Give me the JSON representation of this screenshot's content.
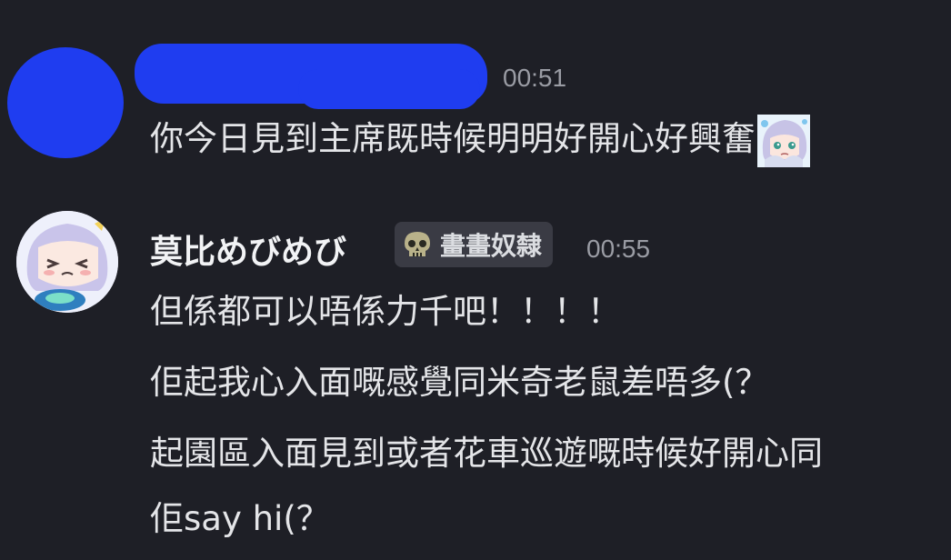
{
  "messages": [
    {
      "author_redacted": true,
      "time": "00:51",
      "lines": [
        "你今日見到主席既時候明明好開心好興奮"
      ],
      "trailing_emoji": "custom-anime-girl-emoji"
    },
    {
      "author": "莫比めびめび",
      "role_tag": "畫畫奴隸",
      "role_icon": "skull-icon",
      "time": "00:55",
      "lines": [
        "但係都可以唔係力千吧！！！！",
        "佢起我心入面嘅感覺同米奇老鼠差唔多(？",
        "起園區入面見到或者花車巡遊嘅時候好開心同",
        "佢say hi(？"
      ]
    }
  ],
  "colors": {
    "background": "#1e1f26",
    "redaction": "#1f3df0",
    "text": "#e4e5e8",
    "timestamp": "#9a9ca4",
    "tag_bg": "#3a3b44"
  }
}
